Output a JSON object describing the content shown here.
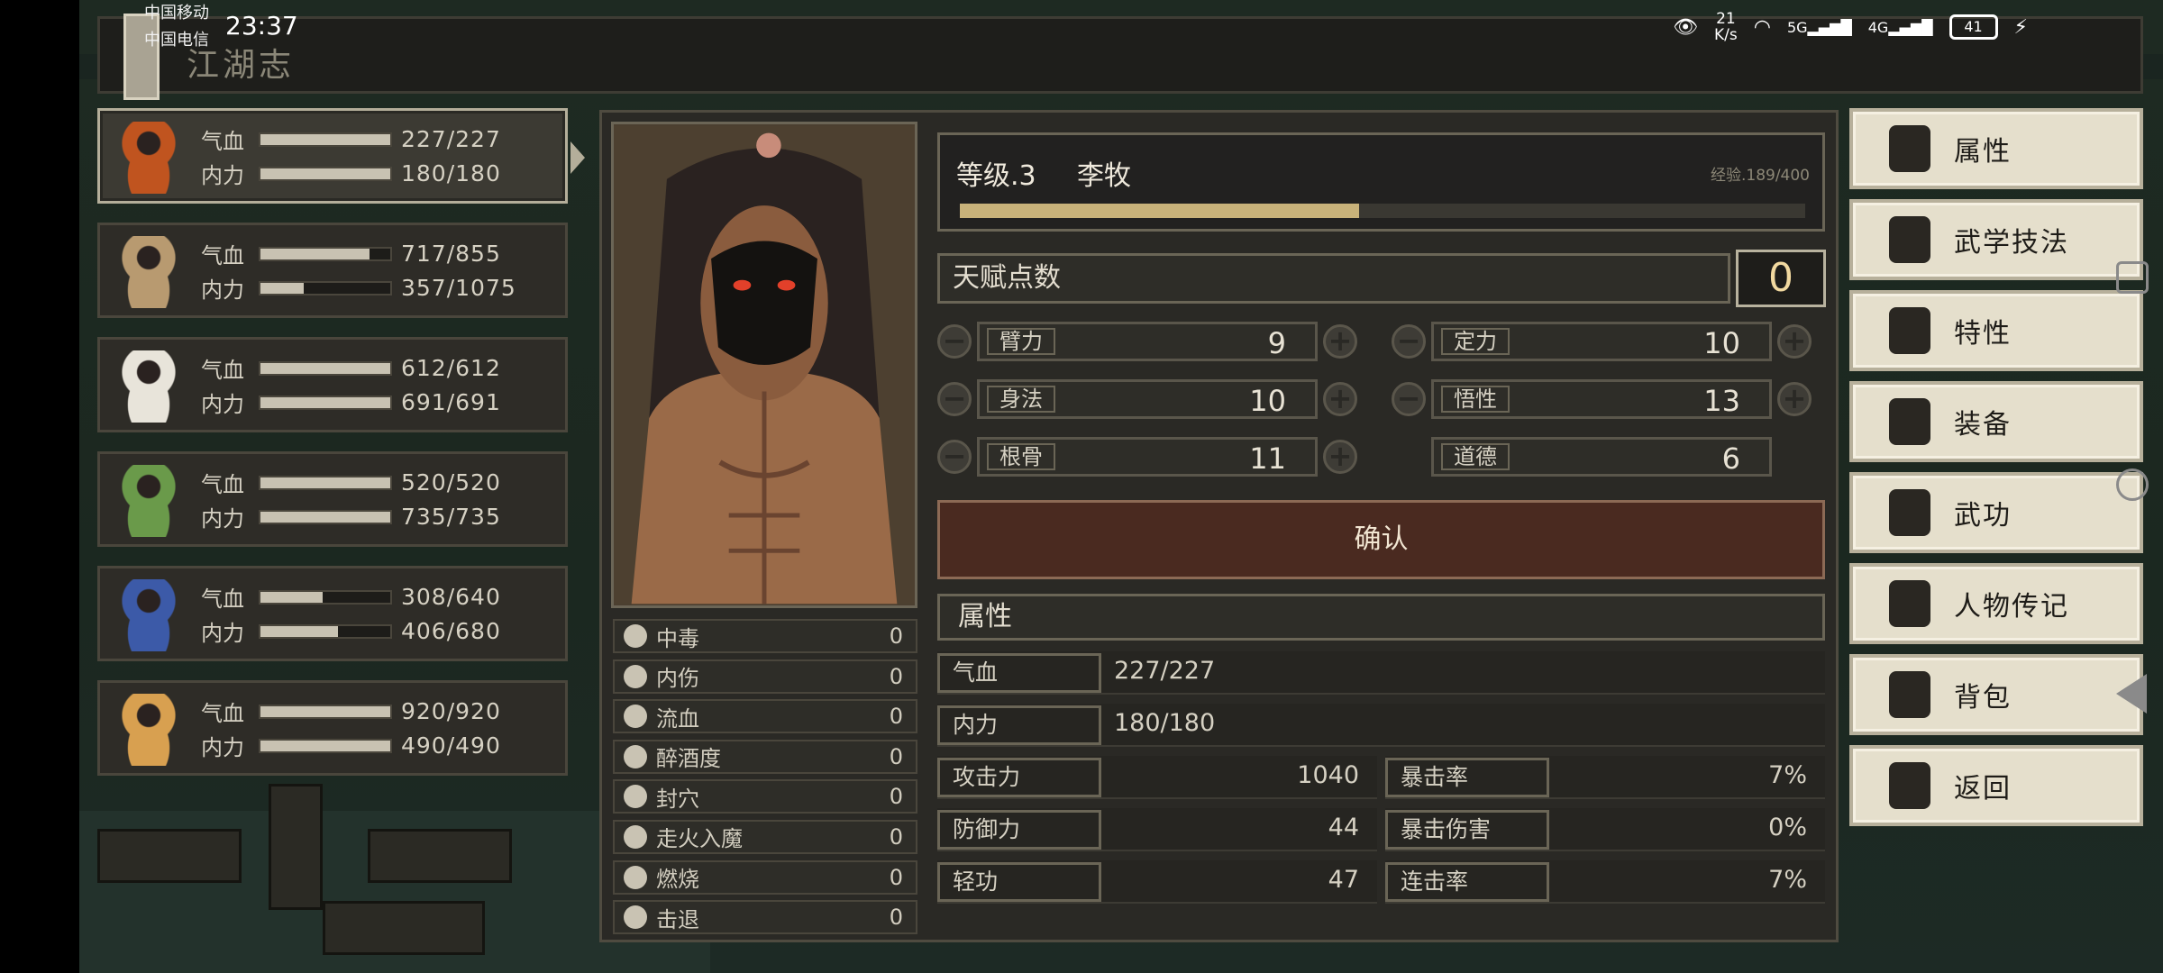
{
  "status_bar": {
    "carrier_1": "中国移动",
    "carrier_2": "中国电信",
    "time": "23:37",
    "net_speed_value": "21",
    "net_speed_unit": "K/s",
    "net_1": "5G",
    "net_2": "4G",
    "battery": "41"
  },
  "header": {
    "title": "江湖志"
  },
  "party": [
    {
      "hp_label": "气血",
      "mp_label": "内力",
      "hp": "227/227",
      "mp": "180/180",
      "hp_frac": 1.0,
      "mp_frac": 1.0,
      "active": true,
      "sprite_color": "#c0541f"
    },
    {
      "hp_label": "气血",
      "mp_label": "内力",
      "hp": "717/855",
      "mp": "357/1075",
      "hp_frac": 0.84,
      "mp_frac": 0.33,
      "active": false,
      "sprite_color": "#b89a70"
    },
    {
      "hp_label": "气血",
      "mp_label": "内力",
      "hp": "612/612",
      "mp": "691/691",
      "hp_frac": 1.0,
      "mp_frac": 1.0,
      "active": false,
      "sprite_color": "#e8e4da"
    },
    {
      "hp_label": "气血",
      "mp_label": "内力",
      "hp": "520/520",
      "mp": "735/735",
      "hp_frac": 1.0,
      "mp_frac": 1.0,
      "active": false,
      "sprite_color": "#6a9a4a"
    },
    {
      "hp_label": "气血",
      "mp_label": "内力",
      "hp": "308/640",
      "mp": "406/680",
      "hp_frac": 0.48,
      "mp_frac": 0.6,
      "active": false,
      "sprite_color": "#3c5aa8"
    },
    {
      "hp_label": "气血",
      "mp_label": "内力",
      "hp": "920/920",
      "mp": "490/490",
      "hp_frac": 1.0,
      "mp_frac": 1.0,
      "active": false,
      "sprite_color": "#d8a050"
    }
  ],
  "character": {
    "level_label": "等级.3",
    "name": "李牧",
    "exp_label": "经验.189/400",
    "exp_frac": 0.4725,
    "talent_label": "天赋点数",
    "talent_points": "0",
    "attributes": [
      {
        "name": "臂力",
        "value": "9"
      },
      {
        "name": "定力",
        "value": "10"
      },
      {
        "name": "身法",
        "value": "10"
      },
      {
        "name": "悟性",
        "value": "13"
      },
      {
        "name": "根骨",
        "value": "11"
      },
      {
        "name": "道德",
        "value": "6"
      }
    ],
    "confirm_label": "确认",
    "section_label": "属性",
    "hp_label": "气血",
    "hp": "227/227",
    "mp_label": "内力",
    "mp": "180/180",
    "stats": [
      {
        "name": "攻击力",
        "value": "1040"
      },
      {
        "name": "暴击率",
        "value": "7%"
      },
      {
        "name": "防御力",
        "value": "44"
      },
      {
        "name": "暴击伤害",
        "value": "0%"
      },
      {
        "name": "轻功",
        "value": "47"
      },
      {
        "name": "连击率",
        "value": "7%"
      }
    ],
    "statuses": [
      {
        "name": "中毒",
        "value": "0",
        "icon": "skull-icon"
      },
      {
        "name": "内伤",
        "value": "0",
        "icon": "broken-heart-icon"
      },
      {
        "name": "流血",
        "value": "0",
        "icon": "blood-icon"
      },
      {
        "name": "醉酒度",
        "value": "0",
        "icon": "drunk-icon"
      },
      {
        "name": "封穴",
        "value": "0",
        "icon": "seal-icon"
      },
      {
        "name": "走火入魔",
        "value": "0",
        "icon": "demon-icon"
      },
      {
        "name": "燃烧",
        "value": "0",
        "icon": "fire-icon"
      },
      {
        "name": "击退",
        "value": "0",
        "icon": "knockback-icon"
      }
    ]
  },
  "menu": [
    {
      "label": "属性",
      "icon": "person-icon"
    },
    {
      "label": "武学技法",
      "icon": "technique-icon"
    },
    {
      "label": "特性",
      "icon": "trait-icon"
    },
    {
      "label": "装备",
      "icon": "sword-icon"
    },
    {
      "label": "武功",
      "icon": "book-icon"
    },
    {
      "label": "人物传记",
      "icon": "scroll-icon"
    },
    {
      "label": "背包",
      "icon": "bag-icon"
    },
    {
      "label": "返回",
      "icon": "door-icon"
    }
  ],
  "colors": {
    "accent": "#c8b27a",
    "menu_bg": "#e5dfcc",
    "confirm_bg": "#4a2a20",
    "panel_bg": "#2a2925"
  }
}
